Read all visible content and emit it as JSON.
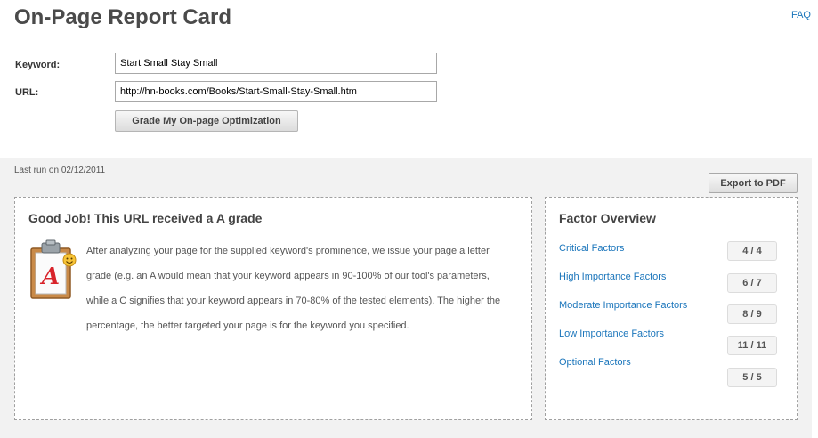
{
  "page": {
    "title": "On-Page Report Card",
    "faq_label": "FAQ"
  },
  "form": {
    "keyword_label": "Keyword:",
    "keyword_value": "Start Small Stay Small",
    "url_label": "URL:",
    "url_value": "http://hn-books.com/Books/Start-Small-Stay-Small.htm",
    "submit_label": "Grade My On-page Optimization"
  },
  "results": {
    "last_run": "Last run on 02/12/2011",
    "export_label": "Export to PDF",
    "grade": {
      "heading": "Good Job! This URL received a A grade",
      "letter": "A",
      "description": "After analyzing your page for the supplied keyword's prominence, we issue your page a letter grade (e.g. an A would mean that your keyword appears in 90-100% of our tool's parameters, while a C signifies that your keyword appears in 70-80% of the tested elements). The higher the percentage, the better targeted your page is for the keyword you specified."
    },
    "factors": {
      "heading": "Factor Overview",
      "items": [
        {
          "label": "Critical Factors",
          "score": "4 / 4"
        },
        {
          "label": "High Importance Factors",
          "score": "6 / 7"
        },
        {
          "label": "Moderate Importance Factors",
          "score": "8 / 9"
        },
        {
          "label": "Low Importance Factors",
          "score": "11 / 11"
        },
        {
          "label": "Optional Factors",
          "score": "5 / 5"
        }
      ]
    }
  },
  "colors": {
    "link": "#1a75bb",
    "grade_letter": "#d8232a",
    "clipboard": "#c98a48"
  },
  "icons": {
    "report": "clipboard-grade-icon",
    "smiley": "smiley-icon"
  }
}
